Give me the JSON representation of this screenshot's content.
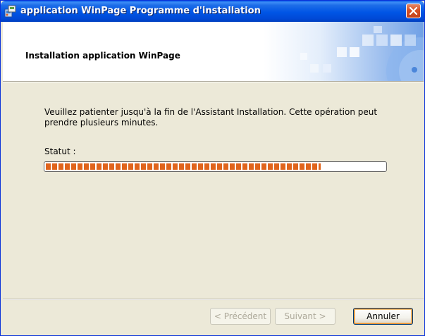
{
  "window": {
    "title": "application WinPage Programme d'installation",
    "icon": "installer-icon",
    "close_icon": "close-icon"
  },
  "header": {
    "title": "Installation application WinPage"
  },
  "main": {
    "message": "Veuillez patienter jusqu'à la fin de l'Assistant Installation. Cette opération peut prendre plusieurs minutes.",
    "status_label": "Statut :",
    "progress_fraction": 0.81,
    "progress_color": "#E0641C"
  },
  "buttons": {
    "back": "< Précédent",
    "next": "Suivant >",
    "cancel": "Annuler"
  },
  "colors": {
    "titlebar": "#0055E5",
    "close": "#D65024",
    "dialog_bg": "#ECE9D8"
  }
}
